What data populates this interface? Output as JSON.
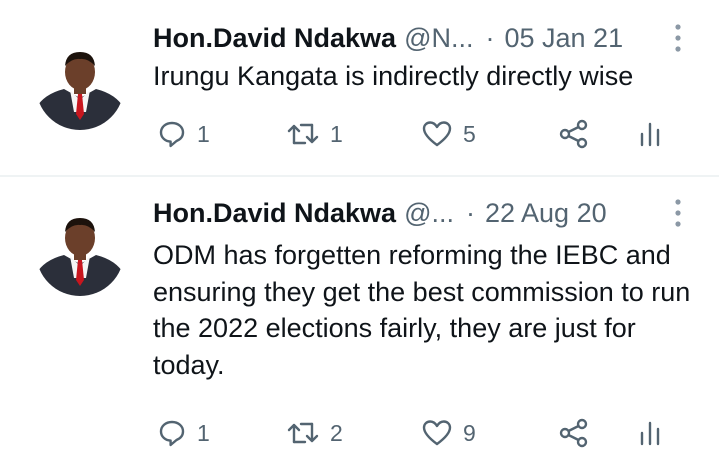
{
  "tweets": [
    {
      "author_name": "Hon.David Ndakwa",
      "handle": "@N...",
      "separator": "·",
      "date": "05 Jan 21",
      "text": "Irungu Kangata is indirectly directly wise",
      "replies": "1",
      "retweets": "1",
      "likes": "5"
    },
    {
      "author_name": "Hon.David Ndakwa",
      "handle": "@...",
      "separator": "·",
      "date": "22 Aug 20",
      "text": "ODM has forgetten reforming the IEBC and ensuring they get the best commission to run the 2022 elections fairly, they are just for today.",
      "replies": "1",
      "retweets": "2",
      "likes": "9"
    }
  ],
  "icons": {
    "reply": "reply-icon",
    "retweet": "retweet-icon",
    "like": "heart-icon",
    "share": "share-icon",
    "stats": "stats-icon",
    "more": "more-icon"
  },
  "colors": {
    "text": "#0f1419",
    "secondary": "#536471",
    "divider": "#eff3f4"
  }
}
